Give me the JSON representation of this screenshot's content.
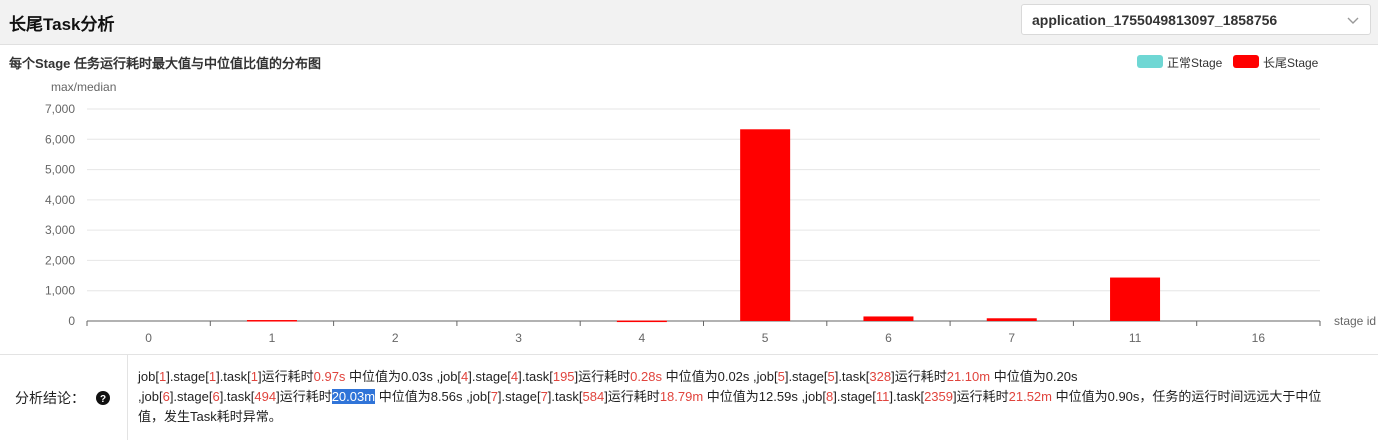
{
  "header": {
    "title": "长尾Task分析",
    "app_id": "application_1755049813097_1858756"
  },
  "chart_title": "每个Stage 任务运行耗时最大值与中位值比值的分布图",
  "legend": [
    {
      "label": "正常Stage",
      "color": "#6fd7d4"
    },
    {
      "label": "长尾Stage",
      "color": "#ff0000"
    }
  ],
  "chart_data": {
    "type": "bar",
    "ylabel": "max/median",
    "xlabel": "stage id",
    "ylim": [
      0,
      7000
    ],
    "yticks": [
      0,
      1000,
      2000,
      3000,
      4000,
      5000,
      6000,
      7000
    ],
    "ytick_labels": [
      "0",
      "1,000",
      "2,000",
      "3,000",
      "4,000",
      "5,000",
      "6,000",
      "7,000"
    ],
    "categories": [
      "0",
      "1",
      "2",
      "3",
      "4",
      "5",
      "6",
      "7",
      "11",
      "16"
    ],
    "series": [
      {
        "name": "长尾Stage",
        "values": [
          0,
          32,
          0,
          0,
          14,
          6330,
          150,
          90,
          1435,
          0
        ]
      }
    ],
    "grid": true,
    "legend_position": "top-right"
  },
  "analysis": {
    "label": "分析结论：",
    "line1": [
      {
        "t": "job["
      },
      {
        "t": "1",
        "c": "red"
      },
      {
        "t": "].stage["
      },
      {
        "t": "1",
        "c": "red"
      },
      {
        "t": "].task["
      },
      {
        "t": "1",
        "c": "red"
      },
      {
        "t": "]运行耗时"
      },
      {
        "t": "0.97s",
        "c": "red"
      },
      {
        "t": " 中位值为0.03s ,job["
      },
      {
        "t": "4",
        "c": "red"
      },
      {
        "t": "].stage["
      },
      {
        "t": "4",
        "c": "red"
      },
      {
        "t": "].task["
      },
      {
        "t": "195",
        "c": "red"
      },
      {
        "t": "]运行耗时"
      },
      {
        "t": "0.28s",
        "c": "red"
      },
      {
        "t": " 中位值为0.02s ,job["
      },
      {
        "t": "5",
        "c": "red"
      },
      {
        "t": "].stage["
      },
      {
        "t": "5",
        "c": "red"
      },
      {
        "t": "].task["
      },
      {
        "t": "328",
        "c": "red"
      },
      {
        "t": "]运行耗时"
      },
      {
        "t": "21.10m",
        "c": "red"
      },
      {
        "t": " 中位值为0.20s"
      }
    ],
    "line2": [
      {
        "t": ",job["
      },
      {
        "t": "6",
        "c": "red"
      },
      {
        "t": "].stage["
      },
      {
        "t": "6",
        "c": "red"
      },
      {
        "t": "].task["
      },
      {
        "t": "494",
        "c": "red"
      },
      {
        "t": "]运行耗时"
      },
      {
        "t": "20.03m",
        "c": "hl"
      },
      {
        "t": " 中位值为8.56s ,job["
      },
      {
        "t": "7",
        "c": "red"
      },
      {
        "t": "].stage["
      },
      {
        "t": "7",
        "c": "red"
      },
      {
        "t": "].task["
      },
      {
        "t": "584",
        "c": "red"
      },
      {
        "t": "]运行耗时"
      },
      {
        "t": "18.79m",
        "c": "red"
      },
      {
        "t": " 中位值为12.59s ,job["
      },
      {
        "t": "8",
        "c": "red"
      },
      {
        "t": "].stage["
      },
      {
        "t": "11",
        "c": "red"
      },
      {
        "t": "].task["
      },
      {
        "t": "2359",
        "c": "red"
      },
      {
        "t": "]运行耗时"
      },
      {
        "t": "21.52m",
        "c": "red"
      },
      {
        "t": " 中位值为0.90s，任务的运行时间远远大于中位值，发生Task耗时异常。"
      }
    ]
  }
}
